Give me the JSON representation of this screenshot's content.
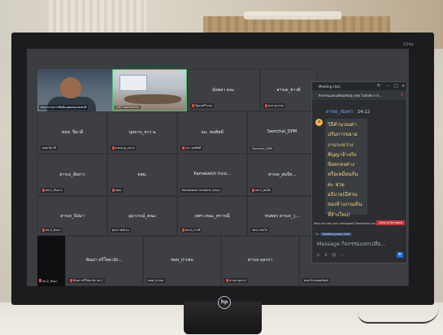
{
  "monitor": {
    "brand_corner": "V24e",
    "logo": "hp"
  },
  "video_tiles": [
    {
      "label": "คณะกรรมการสิทธิมนุษยชนแห่งชาติ"
    },
    {
      "label": "DSI Conference"
    }
  ],
  "participants": [
    {
      "name": "",
      "label": ""
    },
    {
      "name": "มัลพลา คณ.",
      "label": "รัฐมนตรี กลม"
    },
    {
      "name": "สารเด_ชาวติ",
      "label": "สนร.สุวรรณ"
    },
    {
      "name": "ทอท. ปีมาดี",
      "label": "ทอท.จิดาลี"
    },
    {
      "name": "บุษบาบ_ชาร ๒",
      "label": "นพรบ.ญ_กท ค"
    },
    {
      "name": "นน. ชนพิชดี",
      "label": "นน. ชนพิชดี"
    },
    {
      "name": "Samchai_DPM",
      "label": "Samchai_DPM"
    },
    {
      "name": "สารเอ_ลัยยาว",
      "label": "กท.1_กันยาว"
    },
    {
      "name": "ทสม.",
      "label": "ทสม."
    },
    {
      "name": "Kamalwich Inco...",
      "label": "Kamalwich Incolens (กทม.)"
    },
    {
      "name": "สารเด_สมปัย...",
      "label": "กท.2_สมปัย"
    },
    {
      "name": "สารเด_นิปมา",
      "label": "กท.3_นิปมา"
    },
    {
      "name": "อุมาภรณ์_คณะ",
      "label": "อุมาภรณ์_คณะ"
    },
    {
      "name": "เทศา.คณะ_ศรารณี",
      "label": "เทศา.คณะ_ศรารณี"
    },
    {
      "name": "ทนพจร สารเด_วุ...",
      "label": "ทนพจร สารเด"
    },
    {
      "name": "",
      "label": "กท.2_กันยา"
    },
    {
      "name": "",
      "label": "ศุภกร พลังวน"
    },
    {
      "name": "",
      "label": "ทท.2_การดี"
    },
    {
      "name": "",
      "label": "รศรร รพะไอ"
    },
    {
      "name": "ษัณยา ศรีโพธาอัง...",
      "label": "ษัณยา ศรีโพธาอัง กท.2"
    },
    {
      "name": "ทอท_ปาเซน",
      "label": "ทอท_ปาเซน"
    },
    {
      "name": "สารเด ดุธรรา",
      "label": "สารเด ดุธรรา"
    },
    {
      "name": "",
      "label": "ทอท SunkaoDept"
    }
  ],
  "chat": {
    "window_title": "Meeting chat",
    "meeting_title": "กิจกรรมแลกเปลี่ยนเรียนรู้ (KM) ในหัวข้อ การ...",
    "sender": "สารเด_ภัมพรา",
    "time": "14:12",
    "avatar_initial": "ส",
    "message_lines": [
      "วิธีคำนวณค่า",
      "ปรับการขยาย",
      "งานระหว่าง",
      "สัญญาจ้างกับ",
      "ข้อตกลงต่าง",
      "หรือเหมือนกัน",
      "ค่ะ ช่วย",
      "อธิบาย(มีส่วน",
      "ของจ้างงานเดิน",
      "ที่จ้างใหม่)"
    ],
    "notice_text": "Who can see your messages? Recipients can...",
    "notice_badge": "Jump to the latest",
    "to_label": "To:",
    "to_value": "Meeting group chat",
    "compose_placeholder": "Message กิจกรรมแลกเปลี่ย...",
    "icons": [
      "send-icon",
      "attach-icon",
      "emoji-icon",
      "more-icon"
    ]
  }
}
